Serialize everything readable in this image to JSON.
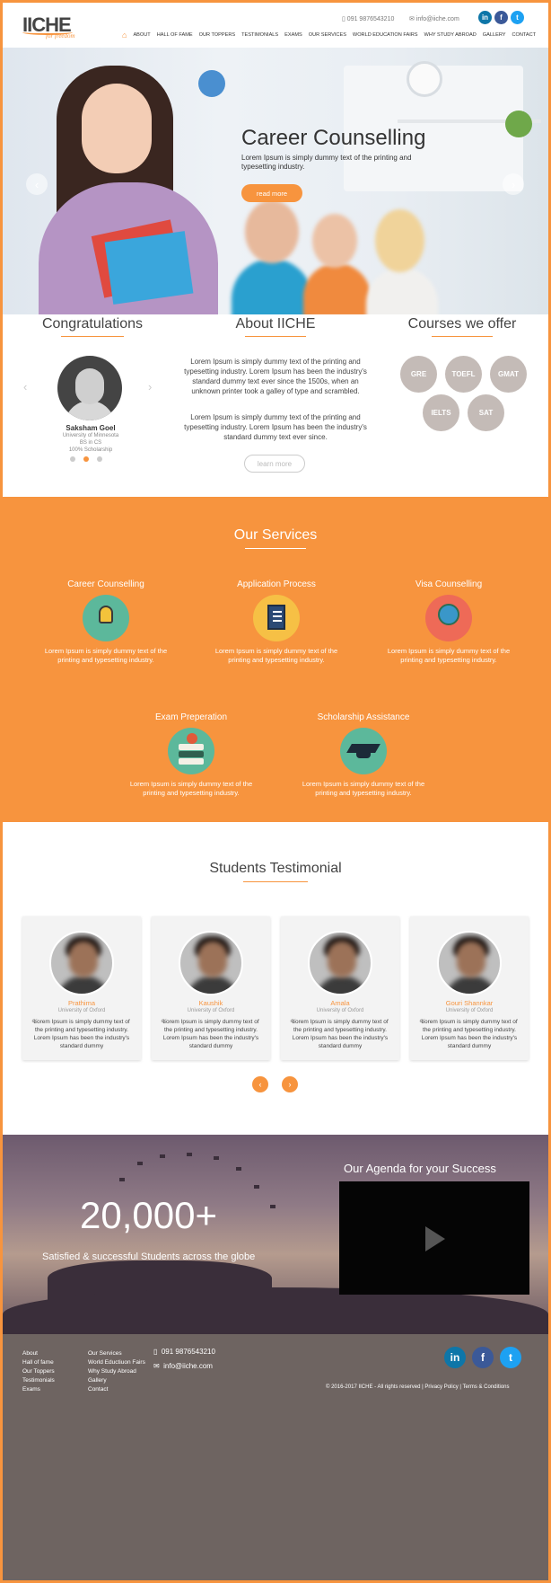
{
  "header": {
    "logo": "IICHE",
    "tagline": "for freedom",
    "phone": "091 9876543210",
    "email": "info@iiche.com",
    "social": [
      "in",
      "f",
      "t"
    ],
    "home_icon": "home-icon",
    "nav": [
      "ABOUT",
      "HALL OF FAME",
      "OUR TOPPERS",
      "TESTIMONIALS",
      "EXAMS",
      "OUR SERVICES",
      "WORLD EDUCATION FAIRS",
      "WHY STUDY ABROAD",
      "GALLERY",
      "CONTACT"
    ]
  },
  "hero": {
    "title": "Career Counselling",
    "text": "Lorem Ipsum is simply dummy text of the printing and typesetting industry.",
    "button": "read more",
    "prev": "‹",
    "next": "›"
  },
  "congrats": {
    "title": "Congratulations",
    "name": "Saksham Goel",
    "lines": [
      "University of Minnesota",
      "BS in CS",
      "100% Scholarship"
    ],
    "prev": "‹",
    "next": "›"
  },
  "about": {
    "title": "About IICHE",
    "p1": "Lorem Ipsum is simply dummy text of the printing and typesetting industry. Lorem Ipsum has been the industry's standard dummy text ever since the 1500s, when an unknown printer took a galley of type and scrambled.",
    "p2": "Lorem Ipsum is simply dummy text of the printing and typesetting industry. Lorem Ipsum has been the industry's standard dummy text ever since.",
    "button": "learn more"
  },
  "courses": {
    "title": "Courses we offer",
    "items": [
      "GRE",
      "TOEFL",
      "GMAT",
      "IELTS",
      "SAT"
    ]
  },
  "services": {
    "title": "Our Services",
    "items": [
      {
        "title": "Career Counselling",
        "text": "Lorem Ipsum is simply dummy text of the printing and typesetting industry.",
        "icon": "lightbulb-icon",
        "color": "#5cb89b"
      },
      {
        "title": "Application Process",
        "text": "Lorem Ipsum is simply dummy text of the printing and typesetting industry.",
        "icon": "document-icon",
        "color": "#f6c045"
      },
      {
        "title": "Visa Counselling",
        "text": "Lorem Ipsum is simply dummy text of the printing and typesetting industry.",
        "icon": "globe-icon",
        "color": "#ee6a57"
      },
      {
        "title": "Exam Preperation",
        "text": "Lorem Ipsum is simply dummy text of the printing and typesetting industry.",
        "icon": "books-icon",
        "color": "#5cb89b"
      },
      {
        "title": "Scholarship Assistance",
        "text": "Lorem Ipsum is simply dummy text of the printing and typesetting industry.",
        "icon": "graduation-cap-icon",
        "color": "#5cb89b"
      }
    ]
  },
  "testimonials": {
    "title": "Students Testimonial",
    "cards": [
      {
        "name": "Prathima",
        "uni": "University of Oxford",
        "text": "Lorem Ipsum is simply dummy text of the printing and typesetting industry. Lorem Ipsum has been the industry's standard dummy"
      },
      {
        "name": "Kaushik",
        "uni": "University of Oxford",
        "text": "Lorem Ipsum is simply dummy text of the printing and typesetting industry. Lorem Ipsum has been the industry's standard dummy"
      },
      {
        "name": "Amala",
        "uni": "University of Oxford",
        "text": "Lorem Ipsum is simply dummy text of the printing and typesetting industry. Lorem Ipsum has been the industry's standard dummy"
      },
      {
        "name": "Gouri Shannkar",
        "uni": "University of Oxford",
        "text": "Lorem Ipsum is simply dummy text of the printing and typesetting industry. Lorem Ipsum has been the industry's standard dummy"
      }
    ],
    "quote": "“",
    "prev": "‹",
    "next": "›"
  },
  "stats": {
    "number": "20,000+",
    "text": "Satisfied & successful Students across the globe",
    "agenda": "Our Agenda for your Success"
  },
  "footer": {
    "col1": [
      "About",
      "Hall of fame",
      "Our Toppers",
      "Testimonials",
      "Exams"
    ],
    "col2": [
      "Our Services",
      "World Eductiuon Fairs",
      "Why Study Abroad",
      "Gallery",
      "Contact"
    ],
    "phone": "091 9876543210",
    "email": "info@iiche.com",
    "copyright": "© 2016-2017 IICHE - All rights reserved | Privacy Policy | Terms & Conditions"
  },
  "colors": {
    "accent": "#f7943e",
    "footer": "#6e6461"
  }
}
